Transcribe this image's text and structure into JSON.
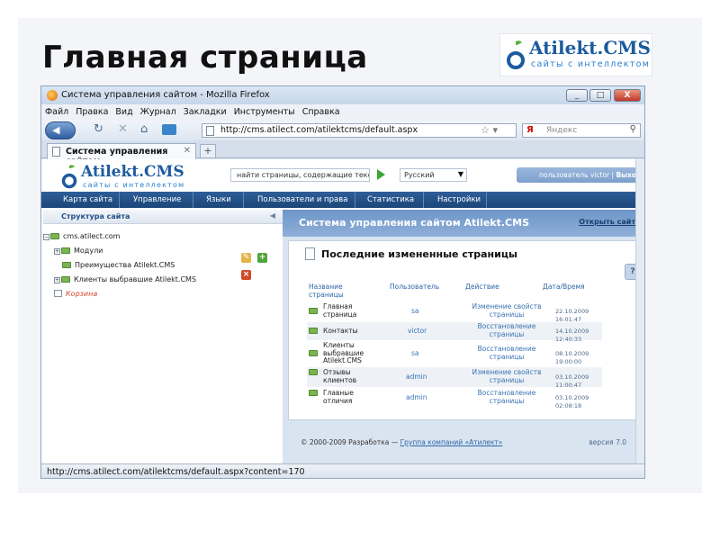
{
  "slide": {
    "title": "Главная страница",
    "logo_name": "Atilekt.CMS",
    "logo_tagline": "сайты с интеллектом"
  },
  "browser": {
    "window_title": "Система управления сайтом - Mozilla Firefox",
    "window_buttons": [
      "_",
      "□",
      "X"
    ],
    "menu": [
      "Файл",
      "Правка",
      "Вид",
      "Журнал",
      "Закладки",
      "Инструменты",
      "Справка"
    ],
    "url": "http://cms.atilect.com/atilektcms/default.aspx",
    "search_engine_label": "Я",
    "search_placeholder": "Яндекс",
    "tab_label": "Система управления сайтом",
    "new_tab_label": "+",
    "status_text": "http://cms.atilect.com/atilektcms/default.aspx?content=170"
  },
  "cms": {
    "logo_name": "Atilekt.CMS",
    "logo_tagline": "сайты с интеллектом",
    "search_placeholder": "найти страницы, содержащие текст...",
    "language": "Русский",
    "user_prefix": "пользователь",
    "user_name": "victor",
    "logout_label": "Выход",
    "nav": [
      "Карта сайта",
      "Управление",
      "Языки",
      "Пользователи и права",
      "Статистика",
      "Настройки"
    ],
    "sidebar": {
      "title": "Структура сайта",
      "tree": [
        "cms.atilect.com",
        "Модули",
        "Преимущества Atilekt.CMS",
        "Клиенты выбравшие Atilekt.CMS",
        "Корзина"
      ]
    },
    "content": {
      "header_title": "Система управления сайтом Atilekt.CMS",
      "open_site_label": "Открыть сайт",
      "panel_title": "Последние измененные страницы",
      "columns": [
        "Название страницы",
        "Пользователь",
        "Действие",
        "Дата/Время"
      ],
      "rows": [
        {
          "name": "Главная страница",
          "user": "sa",
          "action": "Изменение свойств страницы",
          "date": "22.10.2009 16:01:47"
        },
        {
          "name": "Контакты",
          "user": "victor",
          "action": "Восстановление страницы",
          "date": "14.10.2009 12:40:33"
        },
        {
          "name": "Клиенты выбравшие Atilekt.CMS",
          "user": "sa",
          "action": "Восстановление страницы",
          "date": "08.10.2009 19:00:00"
        },
        {
          "name": "Отзывы клиентов",
          "user": "admin",
          "action": "Изменение свойств страницы",
          "date": "03.10.2009 11:00:47"
        },
        {
          "name": "Главные отличия",
          "user": "admin",
          "action": "Восстановление страницы",
          "date": "03.10.2009 02:08:18"
        }
      ],
      "help_label": "?",
      "footer_text": "© 2000-2009 Разработка —",
      "footer_link": "Группа компаний «Атилект»",
      "version": "версия 7.0"
    }
  }
}
